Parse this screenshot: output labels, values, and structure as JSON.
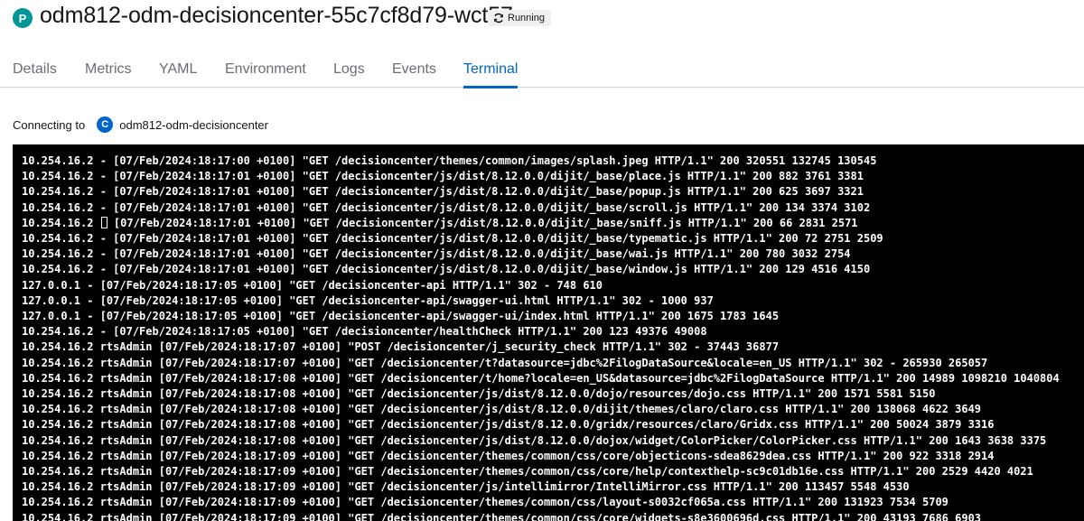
{
  "header": {
    "badge": "P",
    "title": "odm812-odm-decisioncenter-55c7cf8d79-wct57",
    "status": "Running"
  },
  "tabs": [
    {
      "label": "Details"
    },
    {
      "label": "Metrics"
    },
    {
      "label": "YAML"
    },
    {
      "label": "Environment"
    },
    {
      "label": "Logs"
    },
    {
      "label": "Events"
    },
    {
      "label": "Terminal"
    }
  ],
  "active_tab": "Terminal",
  "connecting": {
    "label": "Connecting to",
    "badge": "C",
    "container": "odm812-odm-decisioncenter"
  },
  "terminal": {
    "lines": [
      "10.254.16.2 - [07/Feb/2024:18:17:00 +0100] \"GET /decisioncenter/themes/common/images/splash.jpeg HTTP/1.1\" 200 320551 132745 130545",
      "10.254.16.2 - [07/Feb/2024:18:17:01 +0100] \"GET /decisioncenter/js/dist/8.12.0.0/dijit/_base/place.js HTTP/1.1\" 200 882 3761 3381",
      "10.254.16.2 - [07/Feb/2024:18:17:01 +0100] \"GET /decisioncenter/js/dist/8.12.0.0/dijit/_base/popup.js HTTP/1.1\" 200 625 3697 3321",
      "10.254.16.2 - [07/Feb/2024:18:17:01 +0100] \"GET /decisioncenter/js/dist/8.12.0.0/dijit/_base/scroll.js HTTP/1.1\" 200 134 3374 3102",
      "10.254.16.2 ",
      "10.254.16.2 - [07/Feb/2024:18:17:01 +0100] \"GET /decisioncenter/js/dist/8.12.0.0/dijit/_base/typematic.js HTTP/1.1\" 200 72 2751 2509",
      "10.254.16.2 - [07/Feb/2024:18:17:01 +0100] \"GET /decisioncenter/js/dist/8.12.0.0/dijit/_base/wai.js HTTP/1.1\" 200 780 3032 2754",
      "10.254.16.2 - [07/Feb/2024:18:17:01 +0100] \"GET /decisioncenter/js/dist/8.12.0.0/dijit/_base/window.js HTTP/1.1\" 200 129 4516 4150",
      "127.0.0.1 - [07/Feb/2024:18:17:05 +0100] \"GET /decisioncenter-api HTTP/1.1\" 302 - 748 610",
      "127.0.0.1 - [07/Feb/2024:18:17:05 +0100] \"GET /decisioncenter-api/swagger-ui.html HTTP/1.1\" 302 - 1000 937",
      "127.0.0.1 - [07/Feb/2024:18:17:05 +0100] \"GET /decisioncenter-api/swagger-ui/index.html HTTP/1.1\" 200 1675 1783 1645",
      "10.254.16.2 - [07/Feb/2024:18:17:05 +0100] \"GET /decisioncenter/healthCheck HTTP/1.1\" 200 123 49376 49008",
      "10.254.16.2 rtsAdmin [07/Feb/2024:18:17:07 +0100] \"POST /decisioncenter/j_security_check HTTP/1.1\" 302 - 37443 36877",
      "10.254.16.2 rtsAdmin [07/Feb/2024:18:17:07 +0100] \"GET /decisioncenter/t?datasource=jdbc%2FilogDataSource&locale=en_US HTTP/1.1\" 302 - 265930 265057",
      "10.254.16.2 rtsAdmin [07/Feb/2024:18:17:08 +0100] \"GET /decisioncenter/t/home?locale=en_US&datasource=jdbc%2FilogDataSource HTTP/1.1\" 200 14989 1098210 1040804",
      "10.254.16.2 rtsAdmin [07/Feb/2024:18:17:08 +0100] \"GET /decisioncenter/js/dist/8.12.0.0/dojo/resources/dojo.css HTTP/1.1\" 200 1571 5581 5150",
      "10.254.16.2 rtsAdmin [07/Feb/2024:18:17:08 +0100] \"GET /decisioncenter/js/dist/8.12.0.0/dijit/themes/claro/claro.css HTTP/1.1\" 200 138068 4622 3649",
      "10.254.16.2 rtsAdmin [07/Feb/2024:18:17:08 +0100] \"GET /decisioncenter/js/dist/8.12.0.0/gridx/resources/claro/Gridx.css HTTP/1.1\" 200 50024 3879 3316",
      "10.254.16.2 rtsAdmin [07/Feb/2024:18:17:08 +0100] \"GET /decisioncenter/js/dist/8.12.0.0/dojox/widget/ColorPicker/ColorPicker.css HTTP/1.1\" 200 1643 3638 3375",
      "10.254.16.2 rtsAdmin [07/Feb/2024:18:17:09 +0100] \"GET /decisioncenter/themes/common/css/core/objecticons-sdea8629dea.css HTTP/1.1\" 200 922 3318 2914",
      "10.254.16.2 rtsAdmin [07/Feb/2024:18:17:09 +0100] \"GET /decisioncenter/themes/common/css/core/help/contexthelp-sc9c01db16e.css HTTP/1.1\" 200 2529 4420 4021",
      "10.254.16.2 rtsAdmin [07/Feb/2024:18:17:09 +0100] \"GET /decisioncenter/js/intellimirror/IntelliMirror.css HTTP/1.1\" 200 113457 5548 4530",
      "10.254.16.2 rtsAdmin [07/Feb/2024:18:17:09 +0100] \"GET /decisioncenter/themes/common/css/layout-s0032cf065a.css HTTP/1.1\" 200 131923 7534 5709",
      "10.254.16.2 rtsAdmin [07/Feb/2024:18:17:09 +0100] \"GET /decisioncenter/themes/common/css/core/widgets-s8e3600696d.css HTTP/1.1\" 200 43193 7686 6903"
    ],
    "cursor_line_rest": " [07/Feb/2024:18:17:01 +0100] \"GET /decisioncenter/js/dist/8.12.0.0/dijit/_base/sniff.js HTTP/1.1\" 200 66 2831 2571"
  }
}
